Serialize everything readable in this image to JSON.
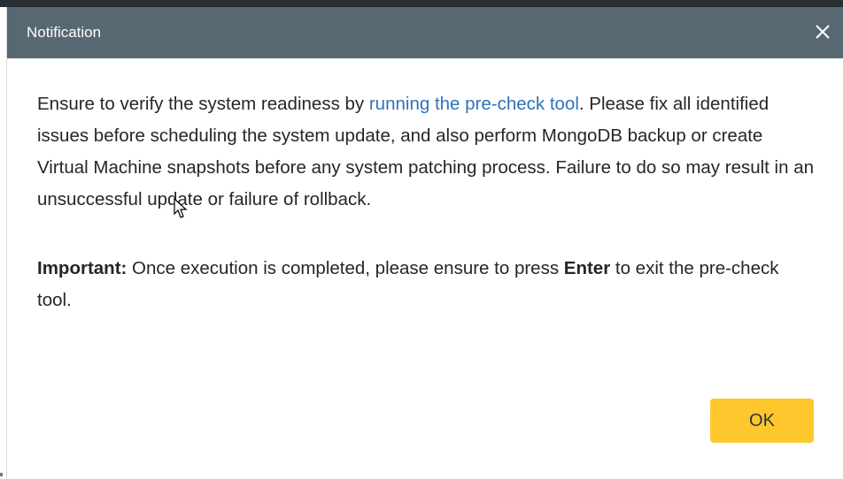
{
  "dialog": {
    "title": "Notification",
    "close_icon": "close-icon",
    "message": {
      "text_before_link": "Ensure to verify the system readiness by ",
      "link_text": "running the pre-check tool",
      "text_after_link": ". Please fix all identified issues before scheduling the system update, and also perform MongoDB backup or create Virtual Machine snapshots before any system patching process. Failure to do so may result in an unsuccessful update or failure of rollback."
    },
    "important": {
      "label": "Important:",
      "text_before_key": " Once execution is completed, please ensure to press ",
      "key": "Enter",
      "text_after_key": " to exit the pre-check tool."
    },
    "ok_label": "OK"
  },
  "colors": {
    "titlebar": "#576872",
    "link": "#2f73b8",
    "ok_button": "#fdc72d"
  }
}
